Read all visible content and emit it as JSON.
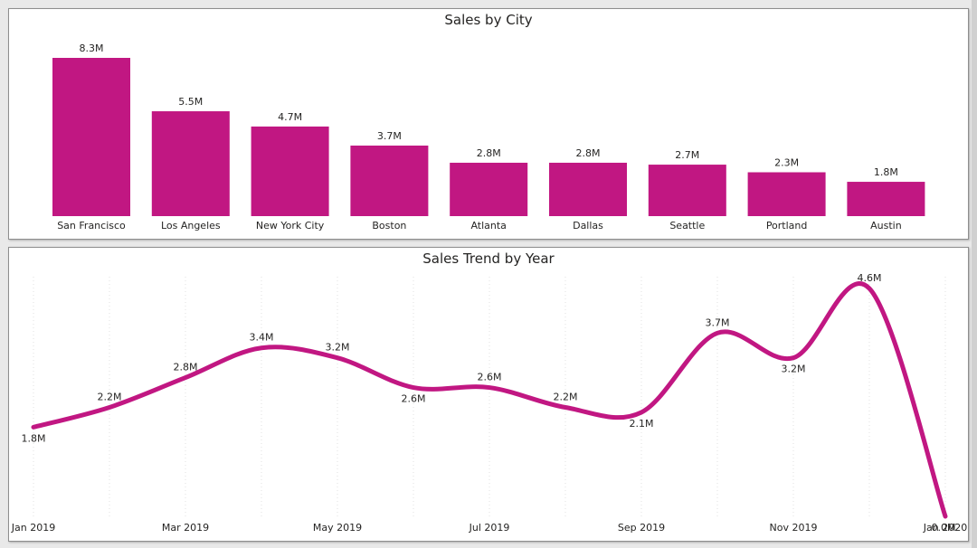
{
  "colors": {
    "series": "#C11782",
    "text": "#252423",
    "grid": "#e0e0e0"
  },
  "chart_data": [
    {
      "type": "bar",
      "title": "Sales by City",
      "categories": [
        "San Francisco",
        "Los Angeles",
        "New York City",
        "Boston",
        "Atlanta",
        "Dallas",
        "Seattle",
        "Portland",
        "Austin"
      ],
      "values": [
        8.3,
        5.5,
        4.7,
        3.7,
        2.8,
        2.8,
        2.7,
        2.3,
        1.8
      ],
      "data_labels": [
        "8.3M",
        "5.5M",
        "4.7M",
        "3.7M",
        "2.8M",
        "2.8M",
        "2.7M",
        "2.3M",
        "1.8M"
      ],
      "unit": "M",
      "ylim": [
        0,
        8.3
      ],
      "grid": false,
      "legend": "none"
    },
    {
      "type": "line",
      "title": "Sales Trend by Year",
      "x": [
        "Jan 2019",
        "Feb 2019",
        "Mar 2019",
        "Apr 2019",
        "May 2019",
        "Jun 2019",
        "Jul 2019",
        "Aug 2019",
        "Sep 2019",
        "Oct 2019",
        "Nov 2019",
        "Dec 2019",
        "Jan 2020"
      ],
      "values": [
        1.8,
        2.2,
        2.8,
        3.4,
        3.2,
        2.6,
        2.6,
        2.2,
        2.1,
        3.7,
        3.2,
        4.6,
        0.0
      ],
      "data_labels": [
        "1.8M",
        "2.2M",
        "2.8M",
        "3.4M",
        "3.2M",
        "2.6M",
        "2.6M",
        "2.2M",
        "2.1M",
        "3.7M",
        "3.2M",
        "4.6M",
        "0.0M"
      ],
      "x_tick_labels": [
        "Jan 2019",
        "Mar 2019",
        "May 2019",
        "Jul 2019",
        "Sep 2019",
        "Nov 2019",
        "Jan 2020"
      ],
      "x_tick_indices": [
        0,
        2,
        4,
        6,
        8,
        10,
        12
      ],
      "ylim": [
        0,
        4.6
      ],
      "grid": true,
      "legend": "none"
    }
  ]
}
